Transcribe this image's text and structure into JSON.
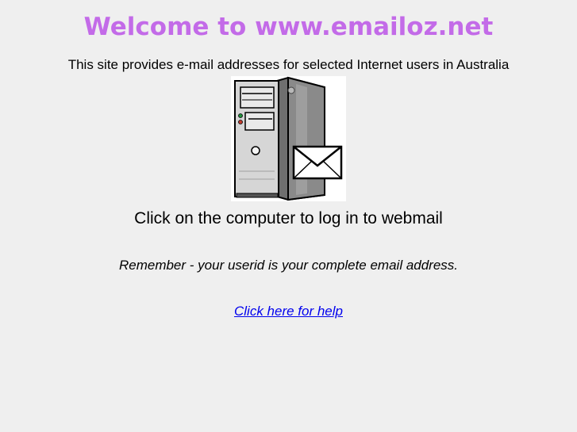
{
  "header": {
    "title": "Welcome to www.emailoz.net",
    "title_color": "#c36be8"
  },
  "intro": {
    "text": "This site provides e-mail addresses for selected Internet users in Australia"
  },
  "computer_image": {
    "icon": "computer-tower-with-envelope-icon"
  },
  "login": {
    "text": "Click on the computer to log in to webmail"
  },
  "reminder": {
    "text": "Remember - your userid is your complete email address."
  },
  "help": {
    "link_text": "Click here for help",
    "link_color": "#0000ee"
  }
}
